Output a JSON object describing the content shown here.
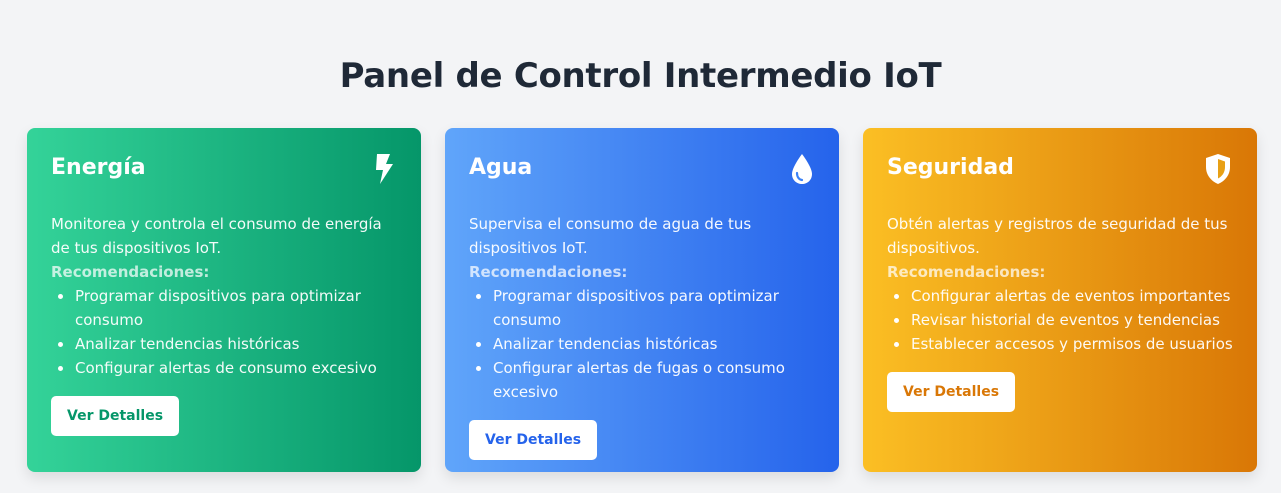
{
  "page": {
    "title": "Panel de Control Intermedio IoT"
  },
  "cards": [
    {
      "title": "Energía",
      "icon": "bolt-icon",
      "description": "Monitorea y controla el consumo de energía de tus dispositivos IoT.",
      "rec_label": "Recomendaciones:",
      "recommendations": [
        "Programar dispositivos para optimizar consumo",
        "Analizar tendencias históricas",
        "Configurar alertas de consumo excesivo"
      ],
      "button": "Ver Detalles",
      "colors": {
        "from": "#34d399",
        "to": "#059669"
      }
    },
    {
      "title": "Agua",
      "icon": "water-drop-icon",
      "description": "Supervisa el consumo de agua de tus dispositivos IoT.",
      "rec_label": "Recomendaciones:",
      "recommendations": [
        "Programar dispositivos para optimizar consumo",
        "Analizar tendencias históricas",
        "Configurar alertas de fugas o consumo excesivo"
      ],
      "button": "Ver Detalles",
      "colors": {
        "from": "#60a5fa",
        "to": "#2563eb"
      }
    },
    {
      "title": "Seguridad",
      "icon": "shield-icon",
      "description": "Obtén alertas y registros de seguridad de tus dispositivos.",
      "rec_label": "Recomendaciones:",
      "recommendations": [
        "Configurar alertas de eventos importantes",
        "Revisar historial de eventos y tendencias",
        "Establecer accesos y permisos de usuarios"
      ],
      "button": "Ver Detalles",
      "colors": {
        "from": "#fbbf24",
        "to": "#d97706"
      }
    }
  ]
}
